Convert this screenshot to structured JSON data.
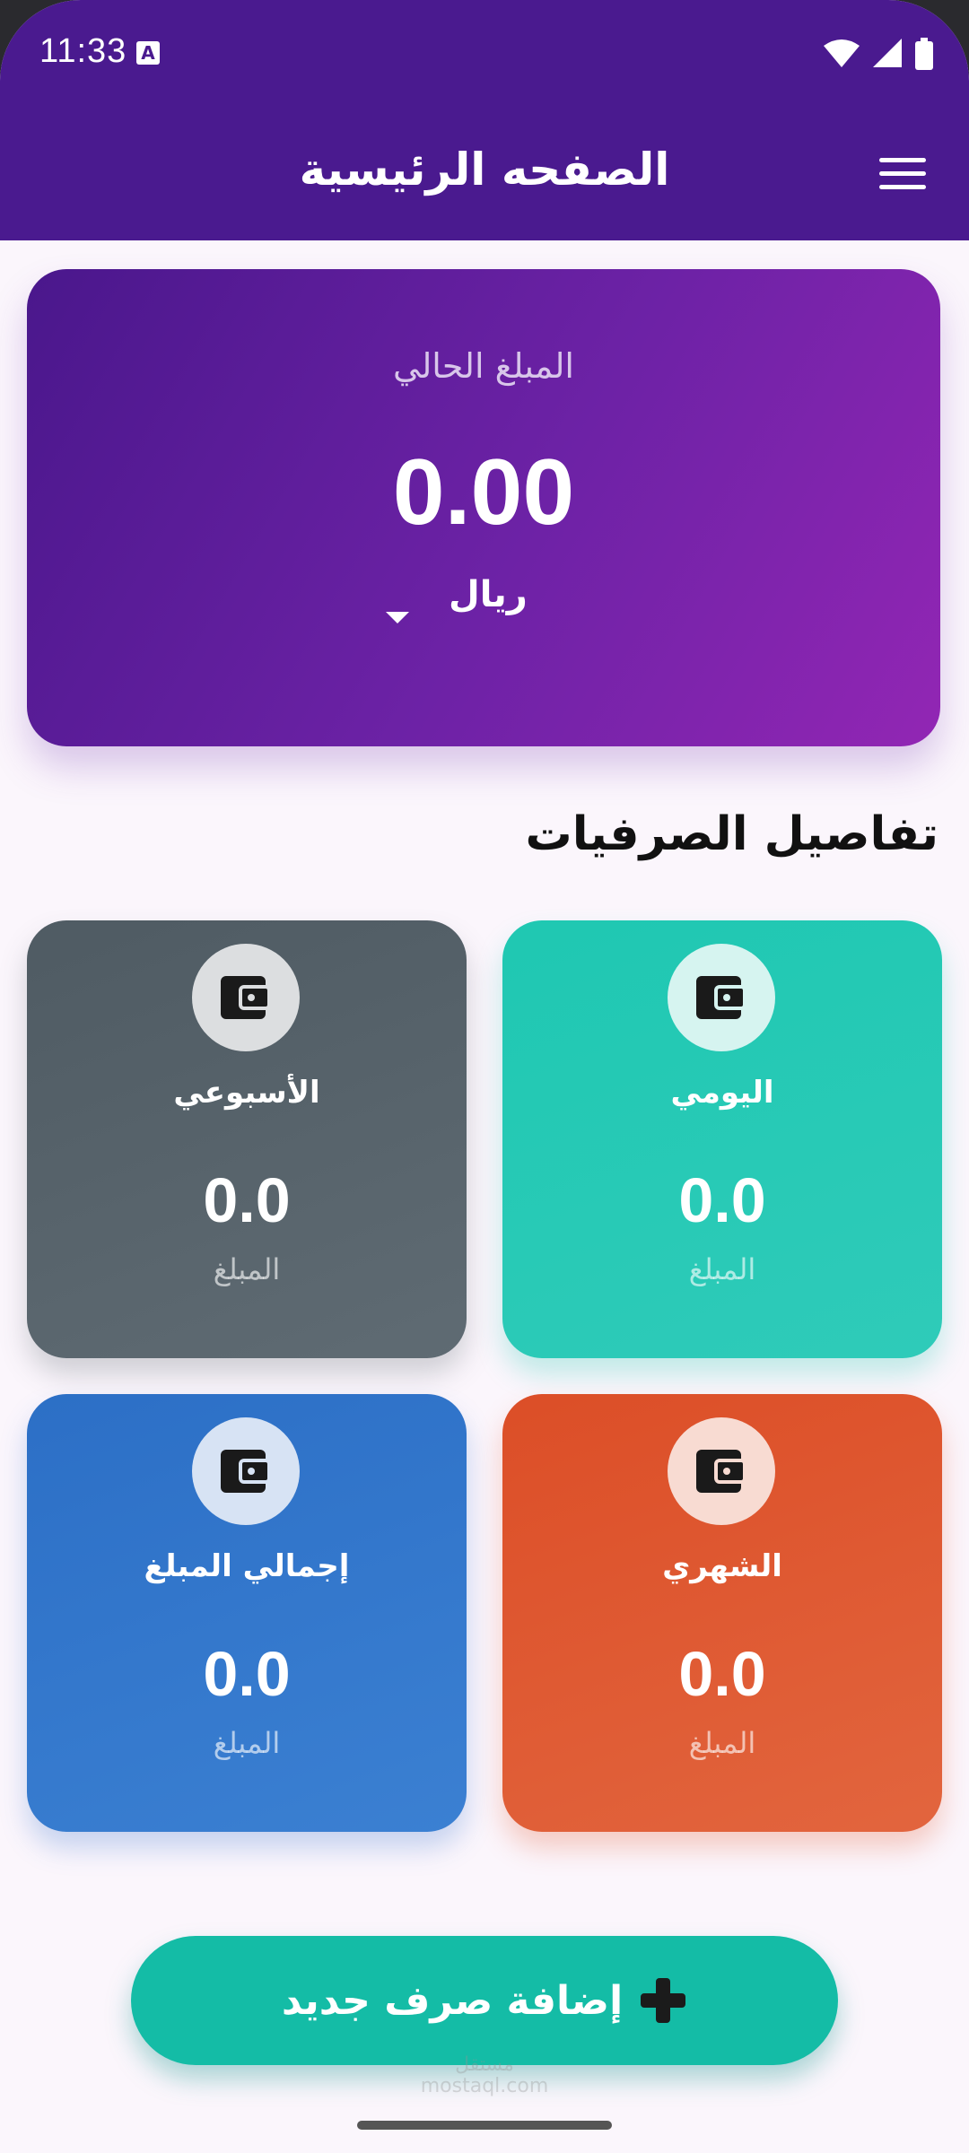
{
  "status_bar": {
    "time": "11:33",
    "notification_glyph": "A"
  },
  "appbar": {
    "title": "الصفحه الرئيسية",
    "menu_icon": "hamburger-menu-icon"
  },
  "balance": {
    "label": "المبلغ الحالي",
    "amount": "0.00",
    "currency": "ريال"
  },
  "section": {
    "title": "تفاصيل الصرفيات"
  },
  "cards": {
    "daily": {
      "title": "اليومي",
      "value": "0.0",
      "sub": "المبلغ",
      "color": "#1fc8b2"
    },
    "weekly": {
      "title": "الأسبوعي",
      "value": "0.0",
      "sub": "المبلغ",
      "color": "#56626a"
    },
    "monthly": {
      "title": "الشهري",
      "value": "0.0",
      "sub": "المبلغ",
      "color": "#dc4e27"
    },
    "total": {
      "title": "إجمالي المبلغ",
      "value": "0.0",
      "sub": "المبلغ",
      "color": "#2c6fc6"
    }
  },
  "add_button": {
    "label": "إضافة صرف جديد"
  },
  "watermark": {
    "line1": "مستقل",
    "line2": "mostaql.com"
  },
  "colors": {
    "appbar": "#4a1a8f",
    "accent": "#14bca6",
    "background": "#fbf6fc"
  }
}
